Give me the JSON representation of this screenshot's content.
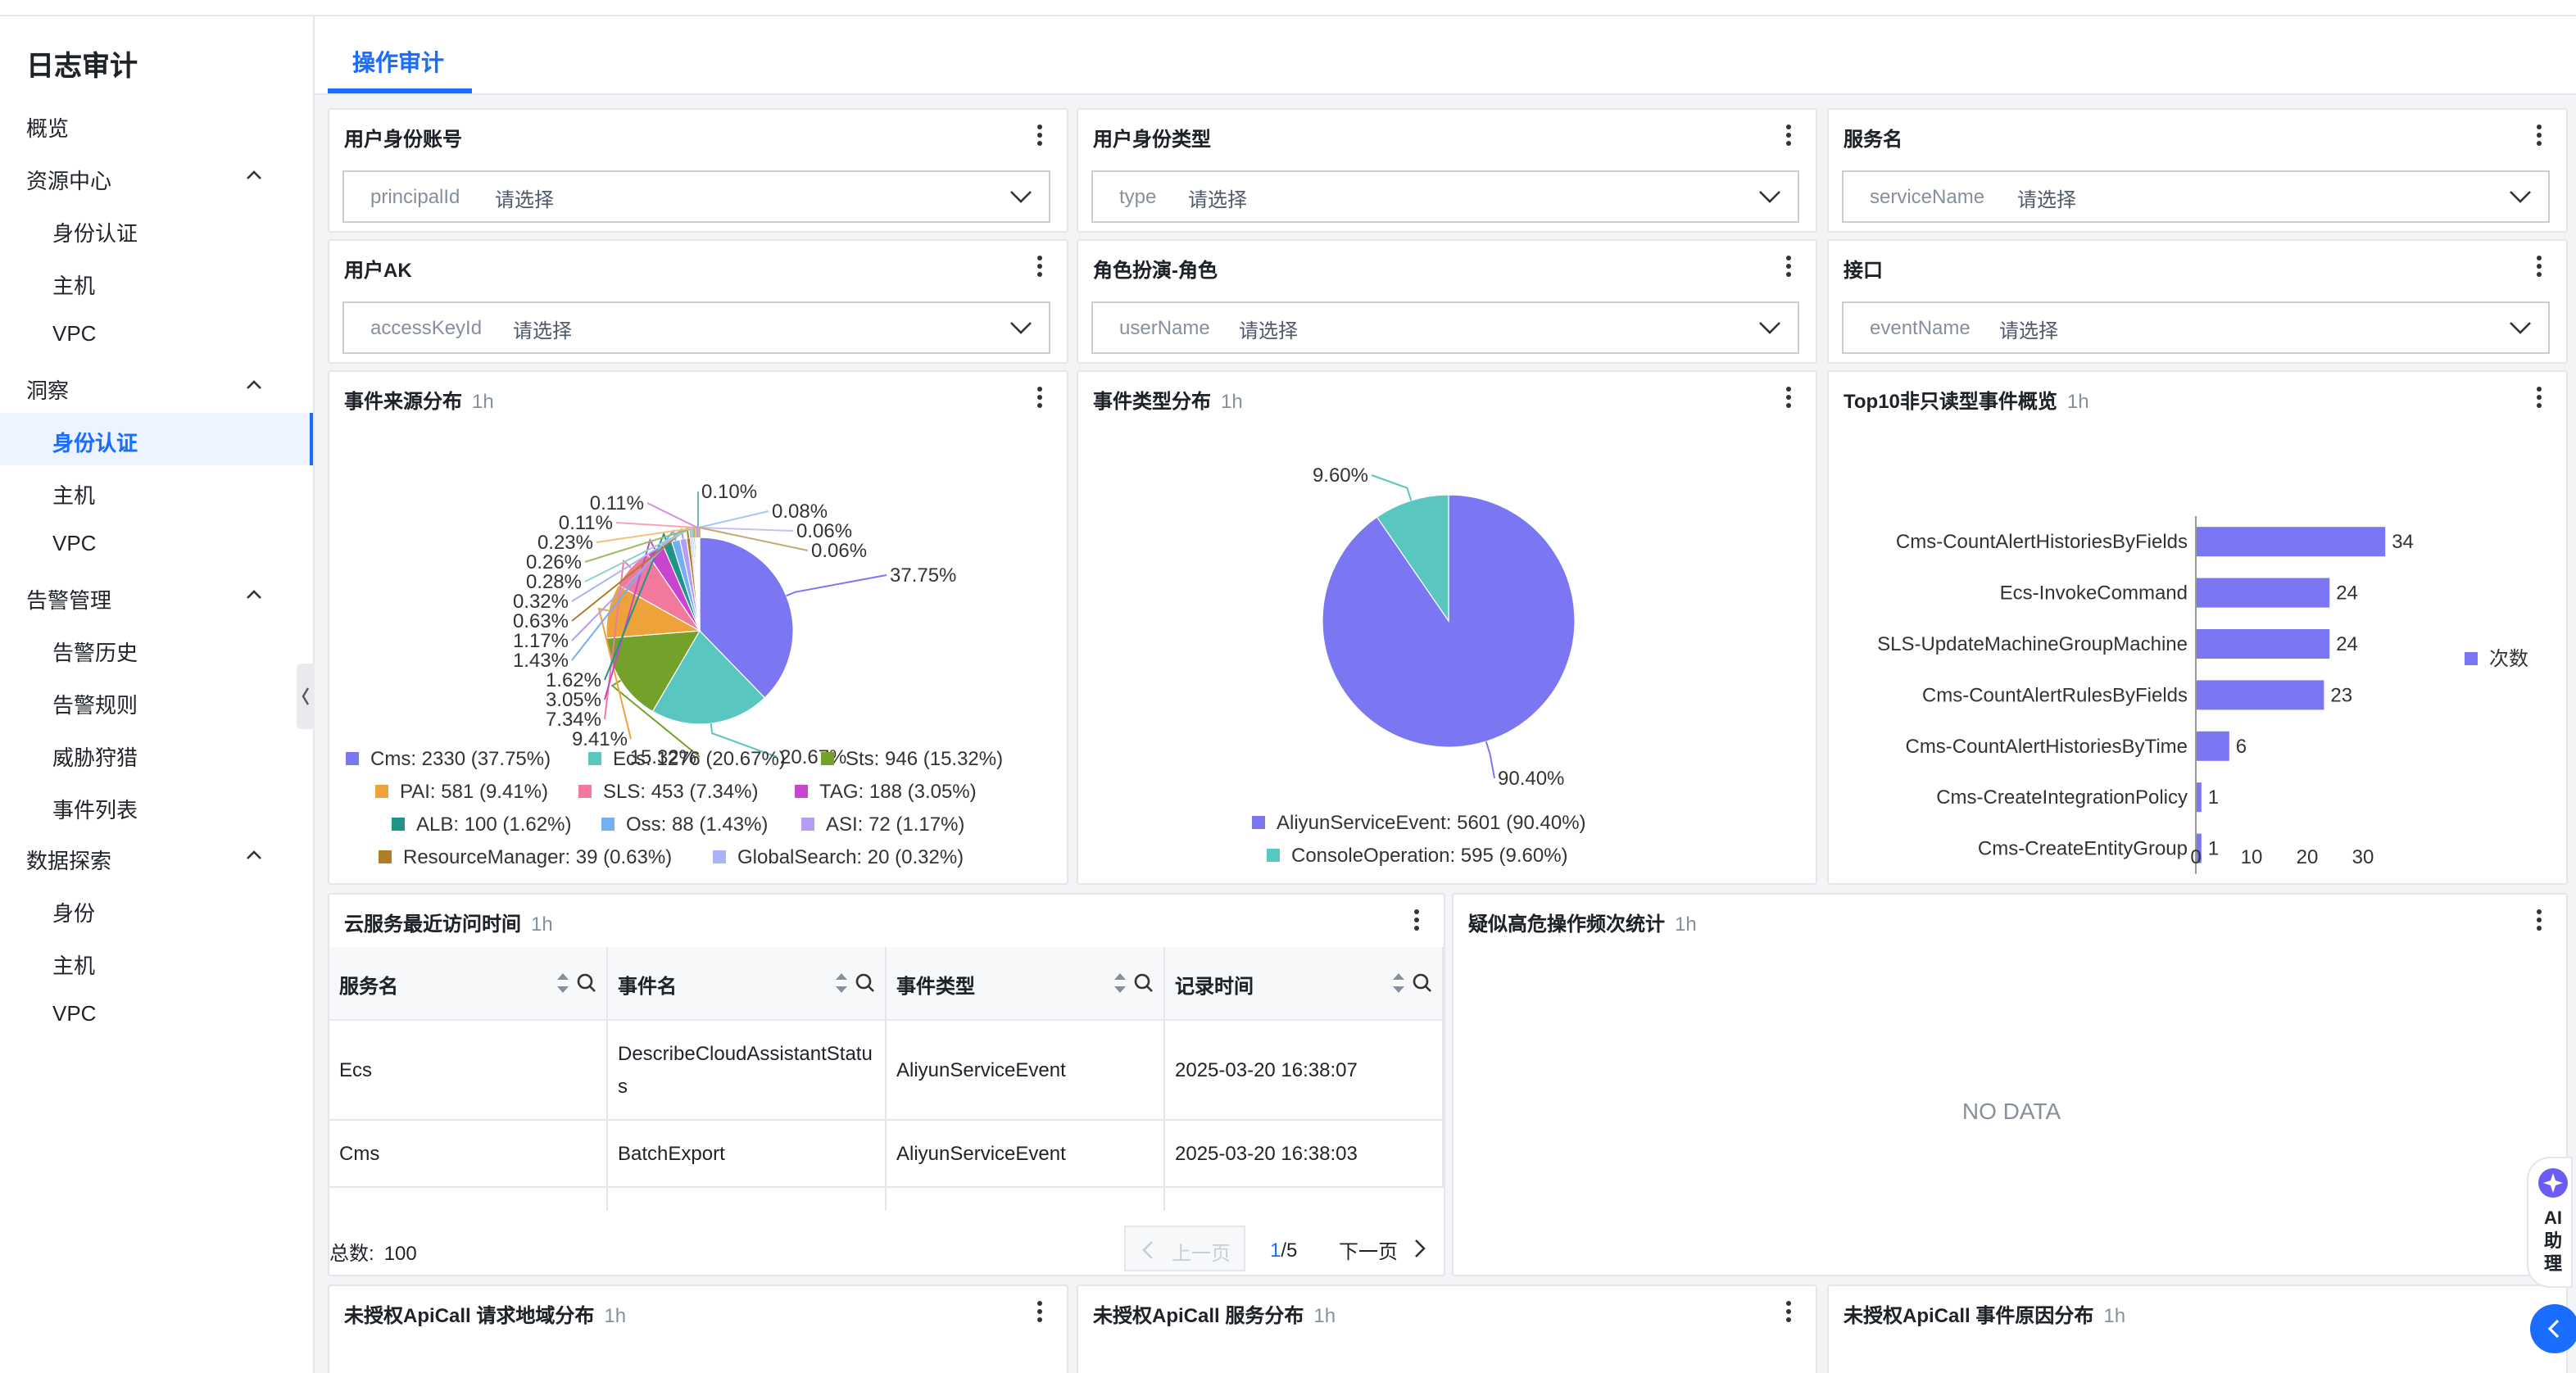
{
  "sidebar": {
    "title": "日志审计",
    "items": [
      {
        "label": "概览"
      },
      {
        "label": "资源中心"
      },
      {
        "label": "身份认证"
      },
      {
        "label": "主机"
      },
      {
        "label": "VPC"
      },
      {
        "label": "洞察"
      },
      {
        "label": "身份认证"
      },
      {
        "label": "主机"
      },
      {
        "label": "VPC"
      },
      {
        "label": "告警管理"
      },
      {
        "label": "告警历史"
      },
      {
        "label": "告警规则"
      },
      {
        "label": "威胁狩猎"
      },
      {
        "label": "事件列表"
      },
      {
        "label": "数据探索"
      },
      {
        "label": "身份"
      },
      {
        "label": "主机"
      },
      {
        "label": "VPC"
      }
    ]
  },
  "tabs": [
    {
      "label": "操作审计"
    }
  ],
  "filters": [
    {
      "title": "用户身份账号",
      "field": "principalId",
      "placeholder": "请选择"
    },
    {
      "title": "用户身份类型",
      "field": "type",
      "placeholder": "请选择"
    },
    {
      "title": "服务名",
      "field": "serviceName",
      "placeholder": "请选择"
    },
    {
      "title": "用户AK",
      "field": "accessKeyId",
      "placeholder": "请选择"
    },
    {
      "title": "角色扮演-角色",
      "field": "userName",
      "placeholder": "请选择"
    },
    {
      "title": "接口",
      "field": "eventName",
      "placeholder": "请选择"
    }
  ],
  "panels": {
    "source": {
      "title": "事件来源分布",
      "range": "1h"
    },
    "type": {
      "title": "事件类型分布",
      "range": "1h"
    },
    "top10": {
      "title": "Top10非只读型事件概览",
      "range": "1h"
    },
    "recent": {
      "title": "云服务最近访问时间",
      "range": "1h"
    },
    "risk": {
      "title": "疑似高危操作频次统计",
      "range": "1h",
      "empty": "NO DATA"
    },
    "unauth_region": {
      "title": "未授权ApiCall 请求地域分布",
      "range": "1h"
    },
    "unauth_service": {
      "title": "未授权ApiCall 服务分布",
      "range": "1h"
    },
    "unauth_reason": {
      "title": "未授权ApiCall 事件原因分布",
      "range": "1h"
    }
  },
  "chart_data": [
    {
      "type": "pie",
      "title": "事件来源分布",
      "slices": [
        {
          "name": "Cms",
          "value": 2330,
          "percent": "37.75%",
          "color": "#7b76f2"
        },
        {
          "name": "Ecs",
          "value": 1276,
          "percent": "20.67%",
          "color": "#59c6c0"
        },
        {
          "name": "Sts",
          "value": 946,
          "percent": "15.32%",
          "color": "#73a12a"
        },
        {
          "name": "PAI",
          "value": 581,
          "percent": "9.41%",
          "color": "#eea23a"
        },
        {
          "name": "SLS",
          "value": 453,
          "percent": "7.34%",
          "color": "#f2799b"
        },
        {
          "name": "TAG",
          "value": 188,
          "percent": "3.05%",
          "color": "#c845cf"
        },
        {
          "name": "ALB",
          "value": 100,
          "percent": "1.62%",
          "color": "#1f948a"
        },
        {
          "name": "Oss",
          "value": 88,
          "percent": "1.43%",
          "color": "#74aef5"
        },
        {
          "name": "ASI",
          "value": 72,
          "percent": "1.17%",
          "color": "#b59cf4"
        },
        {
          "name": "ResourceManager",
          "value": 39,
          "percent": "0.63%",
          "color": "#b07d25"
        },
        {
          "name": "GlobalSearch",
          "value": 20,
          "percent": "0.32%",
          "color": "#aab3f7"
        },
        {
          "name": "",
          "value": 17,
          "percent": "0.28%",
          "color": "#8fd1cc"
        },
        {
          "name": "",
          "value": 16,
          "percent": "0.26%",
          "color": "#9dbb6a"
        },
        {
          "name": "",
          "value": 14,
          "percent": "0.23%",
          "color": "#f0c27a"
        },
        {
          "name": "",
          "value": 7,
          "percent": "0.11%",
          "color": "#f4a5bc"
        },
        {
          "name": "",
          "value": 7,
          "percent": "0.11%",
          "color": "#d58ee0"
        },
        {
          "name": "",
          "value": 6,
          "percent": "0.10%",
          "color": "#6fb9b2"
        },
        {
          "name": "",
          "value": 5,
          "percent": "0.08%",
          "color": "#a3c9f5"
        },
        {
          "name": "",
          "value": 4,
          "percent": "0.06%",
          "color": "#cbbcf7"
        },
        {
          "name": "",
          "value": 4,
          "percent": "0.06%",
          "color": "#c8a871"
        }
      ]
    },
    {
      "type": "pie",
      "title": "事件类型分布",
      "slices": [
        {
          "name": "AliyunServiceEvent",
          "value": 5601,
          "percent": "90.40%",
          "color": "#7b76f2"
        },
        {
          "name": "ConsoleOperation",
          "value": 595,
          "percent": "9.60%",
          "color": "#59c6c0"
        }
      ]
    },
    {
      "type": "bar",
      "orientation": "horizontal",
      "title": "Top10非只读型事件概览",
      "categories": [
        "Cms-CountAlertHistoriesByFields",
        "Ecs-InvokeCommand",
        "SLS-UpdateMachineGroupMachine",
        "Cms-CountAlertRulesByFields",
        "Cms-CountAlertHistoriesByTime",
        "Cms-CreateIntegrationPolicy",
        "Cms-CreateEntityGroup"
      ],
      "series": [
        {
          "name": "次数",
          "values": [
            34,
            24,
            24,
            23,
            6,
            1,
            1
          ],
          "color": "#7b76f2"
        }
      ],
      "xticks": [
        "0",
        "10",
        "20",
        "30"
      ],
      "xlim": [
        0,
        35
      ]
    }
  ],
  "table": {
    "columns": [
      "服务名",
      "事件名",
      "事件类型",
      "记录时间"
    ],
    "rows": [
      [
        "Ecs",
        "DescribeCloudAssistantStatus",
        "AliyunServiceEvent",
        "2025-03-20 16:38:07"
      ],
      [
        "Cms",
        "BatchExport",
        "AliyunServiceEvent",
        "2025-03-20 16:38:03"
      ]
    ],
    "total_label": "总数:",
    "total": "100",
    "prev": "上一页",
    "next": "下一页",
    "page_current": "1",
    "page_total": "/5"
  },
  "assistant": {
    "label": "AI助理"
  }
}
